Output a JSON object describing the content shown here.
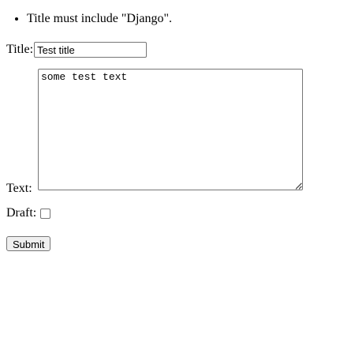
{
  "errors": [
    "Title must include \"Django\"."
  ],
  "form": {
    "title_label": "Title:",
    "title_value": "Test title",
    "text_label": "Text:",
    "text_value": "some test text",
    "draft_label": "Draft:",
    "draft_checked": false,
    "submit_label": "Submit"
  },
  "icons": {
    "resize_grip": "resize-grip-icon"
  },
  "colors": {
    "border": "#767676",
    "button_bg": "#efefef",
    "text": "#000000",
    "background": "#ffffff"
  }
}
